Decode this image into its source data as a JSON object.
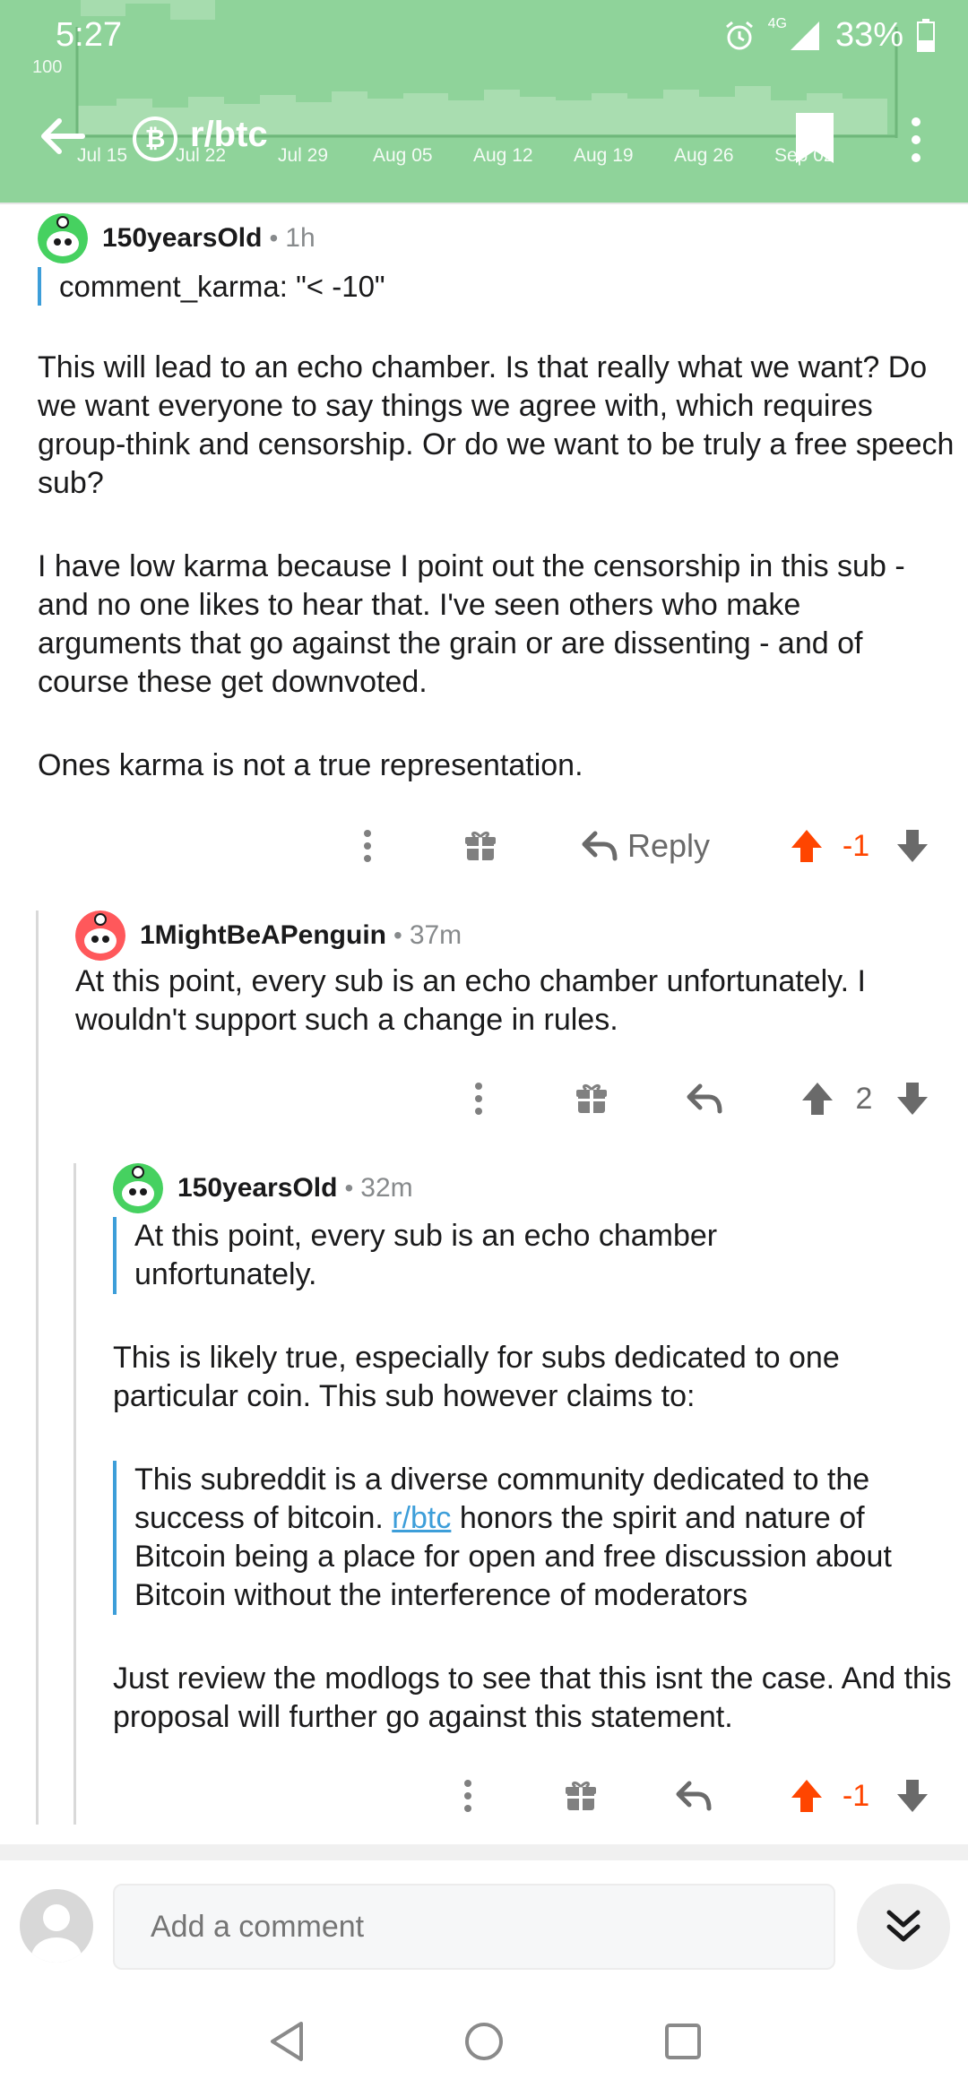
{
  "status": {
    "time": "5:27",
    "network": "4G",
    "battery": "33%"
  },
  "header": {
    "subreddit": "r/btc",
    "chart": {
      "y_label": "100",
      "x_labels": [
        "Jul 15",
        "Jul 22",
        "Jul 29",
        "Aug 05",
        "Aug 12",
        "Aug 19",
        "Aug 26",
        "Sep 02"
      ]
    }
  },
  "comments": [
    {
      "user": "150yearsOld",
      "time": "1h",
      "quote": "comment_karma: \"< -10\"",
      "paragraphs": [
        "This will lead to an echo chamber. Is that really what we want? Do we want everyone to say things we agree with, which requires group-think and censorship. Or do we want to be truly a free speech sub?",
        "I have low karma because I point out the censorship in this sub - and no one likes to hear that. I've seen others who make arguments that go against the grain or are dissenting - and of course these get downvoted.",
        "Ones karma is not a true representation."
      ],
      "reply_label": "Reply",
      "score": "-1"
    },
    {
      "user": "1MightBeAPenguin",
      "time": "37m",
      "paragraphs": [
        "At this point, every sub is an echo chamber unfortunately. I wouldn't support such a change in rules."
      ],
      "score": "2"
    },
    {
      "user": "150yearsOld",
      "time": "32m",
      "quote": "At this point, every sub is an echo chamber unfortunately.",
      "paragraphs": [
        "This is likely true, especially for subs dedicated to one particular coin. This sub however claims to:",
        "Just review the modlogs to see that this isnt the case. And this proposal will further go against this statement."
      ],
      "quote2": {
        "before": "This subreddit is a diverse community dedicated to the success of bitcoin. ",
        "link": "r/btc",
        "after": " honors the spirit and nature of Bitcoin being a place for open and free discussion about Bitcoin without the interference of moderators"
      },
      "score": "-1"
    }
  ],
  "compose": {
    "placeholder": "Add a comment"
  },
  "colors": {
    "header_bg": "#8fd39a",
    "upvote": "#ff4500",
    "quote_bar": "#3d9ed9",
    "link": "#3d9ed9"
  },
  "icons": [
    "back-arrow-icon",
    "bitcoin-icon",
    "bookmark-icon",
    "more-vert-icon",
    "more-vert-icon",
    "gift-icon",
    "reply-icon",
    "upvote-icon",
    "downvote-icon",
    "chevron-double-down-icon",
    "nav-back-icon",
    "nav-home-icon",
    "nav-recents-icon"
  ]
}
